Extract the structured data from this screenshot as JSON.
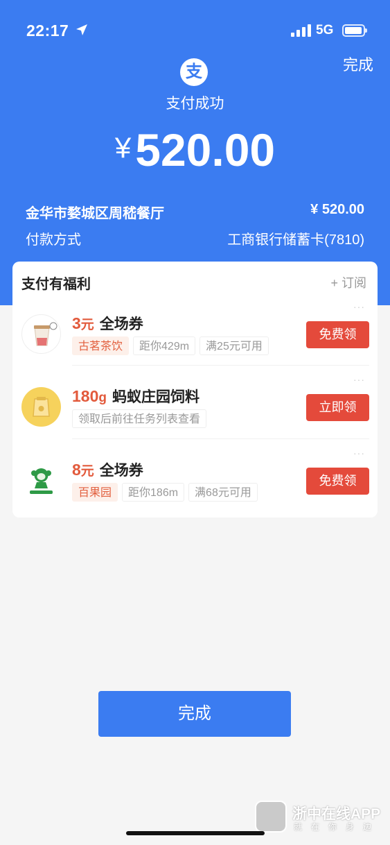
{
  "status_bar": {
    "time": "22:17",
    "network": "5G"
  },
  "header": {
    "done_label": "完成",
    "logo_char": "支",
    "status_text": "支付成功",
    "currency": "¥",
    "amount": "520.00"
  },
  "transaction": {
    "merchant": "金华市婺城区周嵇餐厅",
    "merchant_amount": "¥ 520.00",
    "method_label": "付款方式",
    "method_value": "工商银行储蓄卡(7810)"
  },
  "benefits": {
    "title": "支付有福利",
    "subscribe_label": "+ 订阅",
    "offers": [
      {
        "value": "3",
        "unit": "元",
        "name": "全场券",
        "tags": [
          "古茗茶饮",
          "距你429m",
          "满25元可用"
        ],
        "button": "免费领",
        "avatar_icon": "drink-cup-icon"
      },
      {
        "value": "180",
        "unit": "g",
        "name": "蚂蚁庄园饲料",
        "tags": [
          "领取后前往任务列表查看"
        ],
        "button": "立即领",
        "avatar_icon": "feed-bag-icon"
      },
      {
        "value": "8",
        "unit": "元",
        "name": "全场券",
        "tags": [
          "百果园",
          "距你186m",
          "满68元可用"
        ],
        "button": "免费领",
        "avatar_icon": "pagoda-monkey-icon"
      }
    ]
  },
  "footer": {
    "done_label": "完成"
  },
  "watermark": {
    "title": "浙中在线APP",
    "subtitle": "就在你身边"
  },
  "colors": {
    "primary": "#3b7cf1",
    "accent": "#e44a3b",
    "highlight": "#e25a3c"
  }
}
